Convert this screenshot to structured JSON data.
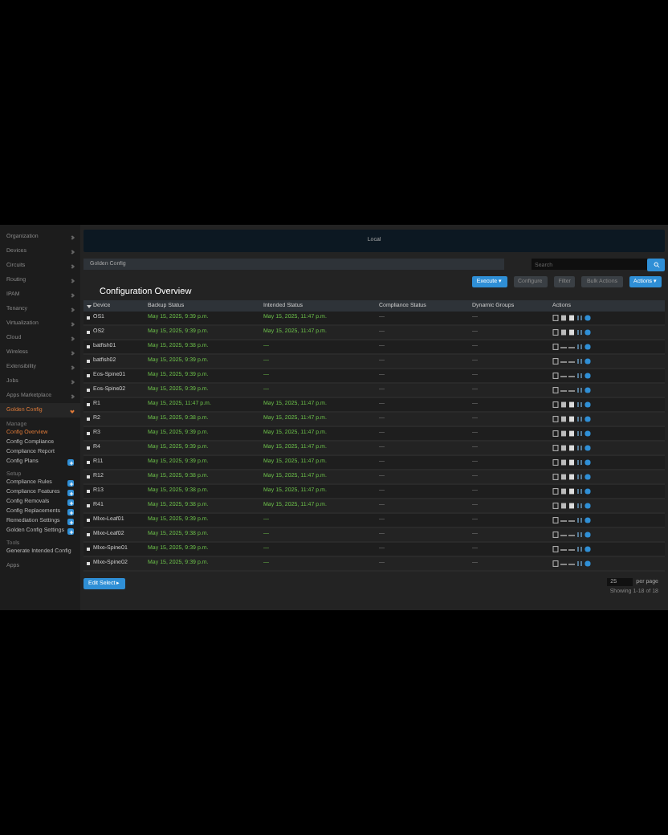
{
  "banner": {
    "text": "Local"
  },
  "sidebar": {
    "items": [
      {
        "label": "Organization",
        "expanded": false
      },
      {
        "label": "Devices",
        "expanded": false
      },
      {
        "label": "Circuits",
        "expanded": false
      },
      {
        "label": "Routing",
        "expanded": false
      },
      {
        "label": "IPAM",
        "expanded": false
      },
      {
        "label": "Tenancy",
        "expanded": false
      },
      {
        "label": "Virtualization",
        "expanded": false
      },
      {
        "label": "Cloud",
        "expanded": false
      },
      {
        "label": "Wireless",
        "expanded": false
      },
      {
        "label": "Extensibility",
        "expanded": false
      },
      {
        "label": "Jobs",
        "expanded": false
      },
      {
        "label": "Apps Marketplace",
        "expanded": false
      },
      {
        "label": "Golden Config",
        "expanded": true
      }
    ],
    "groups": [
      {
        "heading": "Manage",
        "items": [
          {
            "label": "Config Overview",
            "selected": true,
            "add": false
          },
          {
            "label": "Config Compliance",
            "selected": false,
            "add": false
          },
          {
            "label": "Compliance Report",
            "selected": false,
            "add": false
          },
          {
            "label": "Config Plans",
            "selected": false,
            "add": true
          }
        ]
      },
      {
        "heading": "Setup",
        "items": [
          {
            "label": "Compliance Rules",
            "selected": false,
            "add": true
          },
          {
            "label": "Compliance Features",
            "selected": false,
            "add": true
          },
          {
            "label": "Config Removals",
            "selected": false,
            "add": true
          },
          {
            "label": "Config Replacements",
            "selected": false,
            "add": true
          },
          {
            "label": "Remediation Settings",
            "selected": false,
            "add": true
          },
          {
            "label": "Golden Config Settings",
            "selected": false,
            "add": true
          }
        ]
      },
      {
        "heading": "Tools",
        "items": [
          {
            "label": "Generate Intended Config",
            "selected": false,
            "add": false
          }
        ]
      }
    ],
    "footer_item": "Apps"
  },
  "breadcrumb": "Golden Config",
  "search": {
    "placeholder": "Search"
  },
  "toolbar": [
    {
      "label": "Execute ▾",
      "kind": "primary"
    },
    {
      "label": "Configure",
      "kind": "muted"
    },
    {
      "label": "Filter",
      "kind": "muted"
    },
    {
      "label": "Bulk Actions",
      "kind": "muted"
    },
    {
      "label": "Actions ▾",
      "kind": "primary"
    }
  ],
  "title": "Configuration Overview",
  "table": {
    "columns": [
      "Device",
      "Backup Status",
      "Intended Status",
      "Compliance Status",
      "Dynamic Groups",
      "Actions"
    ],
    "rows": [
      {
        "device": "OS1",
        "backup": "May 15, 2025, 9:39 p.m.",
        "intended": "May 15, 2025, 11:47 p.m.",
        "compliance": "—",
        "groups": "—",
        "kind": "full",
        "checked": false
      },
      {
        "device": "OS2",
        "backup": "May 15, 2025, 9:39 p.m.",
        "intended": "May 15, 2025, 11:47 p.m.",
        "compliance": "—",
        "groups": "—",
        "kind": "full",
        "checked": false
      },
      {
        "device": "batfish01",
        "backup": "May 15, 2025, 9:38 p.m.",
        "intended": "—",
        "compliance": "—",
        "groups": "—",
        "kind": "partial",
        "checked": false
      },
      {
        "device": "batfish02",
        "backup": "May 15, 2025, 9:39 p.m.",
        "intended": "—",
        "compliance": "—",
        "groups": "—",
        "kind": "partial",
        "checked": false
      },
      {
        "device": "Eos-Spine01",
        "backup": "May 15, 2025, 9:39 p.m.",
        "intended": "—",
        "compliance": "—",
        "groups": "—",
        "kind": "partial",
        "checked": false
      },
      {
        "device": "Eos-Spine02",
        "backup": "May 15, 2025, 9:39 p.m.",
        "intended": "—",
        "compliance": "—",
        "groups": "—",
        "kind": "partial",
        "checked": false
      },
      {
        "device": "R1",
        "backup": "May 15, 2025, 11:47 p.m.",
        "intended": "May 15, 2025, 11:47 p.m.",
        "compliance": "—",
        "groups": "—",
        "kind": "full",
        "checked": false
      },
      {
        "device": "R2",
        "backup": "May 15, 2025, 9:38 p.m.",
        "intended": "May 15, 2025, 11:47 p.m.",
        "compliance": "—",
        "groups": "—",
        "kind": "full",
        "checked": false
      },
      {
        "device": "R3",
        "backup": "May 15, 2025, 9:39 p.m.",
        "intended": "May 15, 2025, 11:47 p.m.",
        "compliance": "—",
        "groups": "—",
        "kind": "full",
        "checked": false
      },
      {
        "device": "R4",
        "backup": "May 15, 2025, 9:39 p.m.",
        "intended": "May 15, 2025, 11:47 p.m.",
        "compliance": "—",
        "groups": "—",
        "kind": "full",
        "checked": false
      },
      {
        "device": "R11",
        "backup": "May 15, 2025, 9:39 p.m.",
        "intended": "May 15, 2025, 11:47 p.m.",
        "compliance": "—",
        "groups": "—",
        "kind": "full",
        "checked": false
      },
      {
        "device": "R12",
        "backup": "May 15, 2025, 9:38 p.m.",
        "intended": "May 15, 2025, 11:47 p.m.",
        "compliance": "—",
        "groups": "—",
        "kind": "full",
        "checked": false
      },
      {
        "device": "R13",
        "backup": "May 15, 2025, 9:38 p.m.",
        "intended": "May 15, 2025, 11:47 p.m.",
        "compliance": "—",
        "groups": "—",
        "kind": "full",
        "checked": false
      },
      {
        "device": "R41",
        "backup": "May 15, 2025, 9:38 p.m.",
        "intended": "May 15, 2025, 11:47 p.m.",
        "compliance": "—",
        "groups": "—",
        "kind": "full",
        "checked": false
      },
      {
        "device": "Mlxe-Leaf01",
        "backup": "May 15, 2025, 9:39 p.m.",
        "intended": "—",
        "compliance": "—",
        "groups": "—",
        "kind": "partial",
        "checked": false
      },
      {
        "device": "Mlxe-Leaf02",
        "backup": "May 15, 2025, 9:38 p.m.",
        "intended": "—",
        "compliance": "—",
        "groups": "—",
        "kind": "partial",
        "checked": false
      },
      {
        "device": "Mlxe-Spine01",
        "backup": "May 15, 2025, 9:39 p.m.",
        "intended": "—",
        "compliance": "—",
        "groups": "—",
        "kind": "partial",
        "checked": false
      },
      {
        "device": "Mlxe-Spine02",
        "backup": "May 15, 2025, 9:39 p.m.",
        "intended": "—",
        "compliance": "—",
        "groups": "—",
        "kind": "partial",
        "checked": false
      }
    ]
  },
  "bulk_button": "Edit Select ▸",
  "pagination": {
    "per_page": "25",
    "per_page_label": "per page",
    "summary": "Showing 1-18 of 18"
  }
}
